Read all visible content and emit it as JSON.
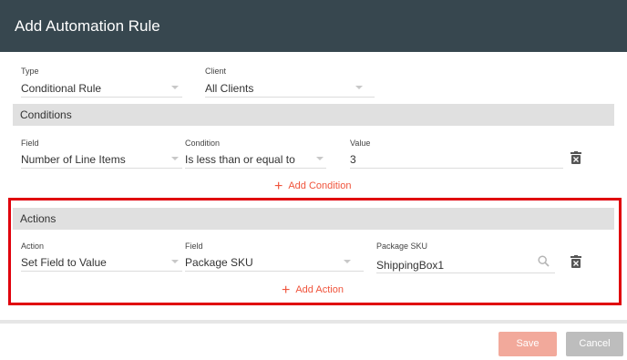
{
  "dialog": {
    "title": "Add Automation Rule"
  },
  "general": {
    "type_label": "Type",
    "type_value": "Conditional Rule",
    "client_label": "Client",
    "client_value": "All Clients"
  },
  "conditions": {
    "title": "Conditions",
    "field_label": "Field",
    "field_value": "Number of Line Items",
    "condition_label": "Condition",
    "condition_value": "Is less than or equal to",
    "value_label": "Value",
    "value_value": "3",
    "add_label": "Add Condition"
  },
  "actions": {
    "title": "Actions",
    "action_label": "Action",
    "action_value": "Set Field to Value",
    "field_label": "Field",
    "field_value": "Package SKU",
    "sku_label": "Package SKU",
    "sku_value": "ShippingBox1",
    "add_label": "Add Action"
  },
  "footer": {
    "save_label": "Save",
    "cancel_label": "Cancel"
  },
  "colors": {
    "header": "#37474f",
    "accent": "#f0543c",
    "highlight_box": "#e0000c"
  }
}
